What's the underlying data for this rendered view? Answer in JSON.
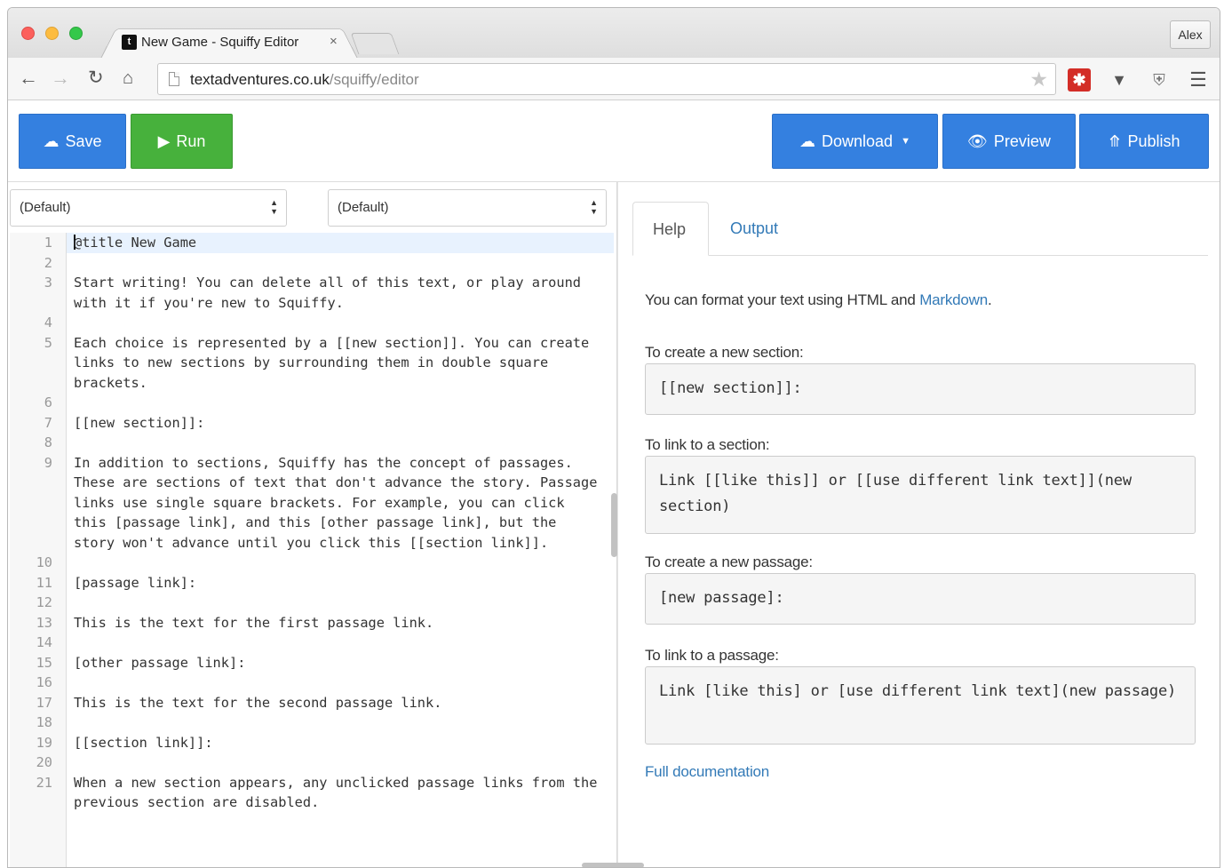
{
  "browser": {
    "tab_title": "New Game - Squiffy Editor",
    "tab_favicon": "t",
    "tab_close": "×",
    "user_name": "Alex",
    "url_host": "textadventures.co.uk",
    "url_path": "/squiffy/editor",
    "icons": {
      "back": "back-arrow-icon",
      "forward": "forward-arrow-icon",
      "reload": "reload-icon",
      "home": "home-icon",
      "bookmark": "star-icon",
      "lastpass": "lastpass-icon",
      "pocket": "pocket-icon",
      "shield": "shield-icon",
      "menu": "hamburger-menu-icon"
    }
  },
  "toolbar": {
    "save_label": "Save",
    "run_label": "Run",
    "download_label": "Download",
    "preview_label": "Preview",
    "publish_label": "Publish",
    "colors": {
      "primary": "#3480e0",
      "success": "#47b13c"
    }
  },
  "selectors": {
    "section_select": "(Default)",
    "passage_select": "(Default)"
  },
  "editor": {
    "lines": [
      {
        "num": "1",
        "text": "@title New Game"
      },
      {
        "num": "2",
        "text": ""
      },
      {
        "num": "3",
        "text": "Start writing! You can delete all of this text, or play around with it if you're new to Squiffy."
      },
      {
        "num": "4",
        "text": ""
      },
      {
        "num": "5",
        "text": "Each choice is represented by a [[new section]]. You can create links to new sections by surrounding them in double square brackets."
      },
      {
        "num": "6",
        "text": ""
      },
      {
        "num": "7",
        "text": "[[new section]]:"
      },
      {
        "num": "8",
        "text": ""
      },
      {
        "num": "9",
        "text": "In addition to sections, Squiffy has the concept of passages. These are sections of text that don't advance the story. Passage links use single square brackets. For example, you can click this [passage link], and this [other passage link], but the story won't advance until you click this [[section link]]."
      },
      {
        "num": "10",
        "text": ""
      },
      {
        "num": "11",
        "text": "[passage link]:"
      },
      {
        "num": "12",
        "text": ""
      },
      {
        "num": "13",
        "text": "This is the text for the first passage link."
      },
      {
        "num": "14",
        "text": ""
      },
      {
        "num": "15",
        "text": "[other passage link]:"
      },
      {
        "num": "16",
        "text": ""
      },
      {
        "num": "17",
        "text": "This is the text for the second passage link."
      },
      {
        "num": "18",
        "text": ""
      },
      {
        "num": "19",
        "text": "[[section link]]:"
      },
      {
        "num": "20",
        "text": ""
      },
      {
        "num": "21",
        "text": "When a new section appears, any unclicked passage links from the previous section are disabled."
      }
    ]
  },
  "tabs": {
    "help": "Help",
    "output": "Output"
  },
  "help": {
    "intro_prefix": "You can format your text using HTML and ",
    "intro_link": "Markdown",
    "intro_suffix": ".",
    "new_section_label": "To create a new section:",
    "new_section_code": "[[new section]]:",
    "link_section_label": "To link to a section:",
    "link_section_code": "Link [[like this]] or [[use different link text]](new section)",
    "new_passage_label": "To create a new passage:",
    "new_passage_code": "[new passage]:",
    "link_passage_label": "To link to a passage:",
    "link_passage_code": "Link [like this] or [use different link text](new passage)",
    "docs_link": "Full documentation"
  }
}
